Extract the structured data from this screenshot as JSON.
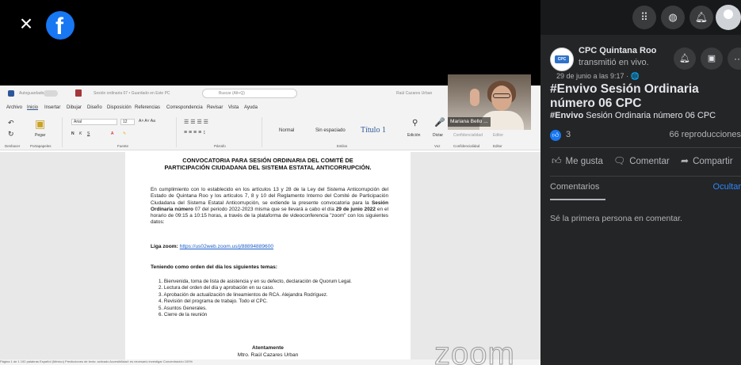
{
  "viewer": {
    "close_glyph": "×",
    "fb_logo_glyph": "f"
  },
  "word": {
    "autosave": "Autoguardado",
    "docname": "Sesión ordinaria 07 • Guardado en Este PC",
    "search": "Buscar (Alt+Q)",
    "user": "Raúl Cazares Urban",
    "menu": [
      "Archivo",
      "Inicio",
      "Insertar",
      "Dibujar",
      "Diseño",
      "Disposición",
      "Referencias",
      "Correspondencia",
      "Revisar",
      "Vista",
      "Ayuda"
    ],
    "ribbon": {
      "paste": "Pegar",
      "font_name": "Arial",
      "font_size": "12",
      "style_normal": "Normal",
      "style_nospacing": "Sin espaciado",
      "style_title": "Título 1",
      "edit": "Edición",
      "dictate": "Dictar",
      "confidentiality": "Confidencialidad",
      "editor": "Editor",
      "groups": [
        "Deshacer",
        "Portapapeles",
        "Fuente",
        "Párrafo",
        "Estilos",
        "Voz",
        "Confidencialidad",
        "Editor"
      ]
    },
    "status": "Página 1 de 1    192 palabras    Español (México)    Predicciones de texto: activado    Accesibilidad: es necesario investigar    Concentración    100%"
  },
  "doc": {
    "title_line1": "CONVOCATORIA PARA SESIÓN ORDINARIA DEL COMITÉ DE",
    "title_line2": "PARTICIPACIÓN CIUDADANA DEL SISTEMA ESTATAL ANTICORRUPCIÓN.",
    "para_1": "En cumplimiento con lo establecido en los artículos 13 y 28 de la Ley del Sistema Anticorrupción del Estado de Quintana Roo y los artículos 7, 8 y 10 del Reglamento Interno del Comité de Participación Ciudadana del Sistema Estatal Anticorrupción, se extiende la presente convocatoria para la",
    "para_bold_1": "Sesión Ordinaria número",
    "para_2": "07 del periodo 2022-2023 misma que se llevará a cabo el día",
    "para_bold_2": "29 de junio 2022",
    "para_3": "en el horario de 09:15 a 10:15 horas, a través de la plataforma de videoconferencia \"zoom\" con los siguientes datos:",
    "link_label": "Liga zoom:",
    "link_url": "https://us02web.zoom.us/j/88894889600",
    "agenda_heading": "Teniendo como orden del día los siguientes temas:",
    "agenda": [
      "1.  Bienvenida, toma de lista de asistencia y en su defecto, declaración de Quorum Legal.",
      "2.  Lectura del orden del día y aprobación en su caso.",
      "3.  Aprobación de actualización de lineamientos de RCA. Alejandra Rodríguez.",
      "4.  Revisión del programa de trabajo. Todo el CPC.",
      "5.  Asuntos Generales.",
      "6.  Cierre de la reunión"
    ],
    "sign_1": "Atentamente",
    "sign_2": "Mtro. Raúl Cazares Urban"
  },
  "webcam": {
    "name": "Mariana Bello ..."
  },
  "zoom_watermark": "zoom",
  "panel": {
    "page_avatar_text": "CPC",
    "page_name": "CPC Quintana Roo",
    "page_sub": "transmitió en vivo.",
    "date": "29 de junio a las 9:17 · 🌐",
    "title": "#Envivo Sesión Ordinaria número 06 CPC",
    "desc_tag": "#Envivo",
    "desc_rest": " Sesión Ordinaria número 06 CPC",
    "likes": "3",
    "views": "66 reproducciones",
    "like_label": "Me gusta",
    "comment_label": "Comentar",
    "share_label": "Compartir",
    "comments_tab": "Comentarios",
    "hide_label": "Ocultar",
    "empty_comments": "Sé la primera persona en comentar."
  },
  "colors": {
    "facebook_blue": "#1877f2",
    "panel_bg": "#242526",
    "word_blue": "#2b579a",
    "link_blue": "#2d88ff"
  },
  "icons": [
    "close-icon",
    "facebook-logo-icon",
    "apps-grid-icon",
    "messenger-icon",
    "notifications-bell-icon",
    "profile-avatar",
    "follow-bell-icon",
    "save-icon",
    "more-options-icon",
    "globe-icon",
    "like-reaction-icon",
    "thumbs-up-icon",
    "comment-icon",
    "share-icon"
  ]
}
